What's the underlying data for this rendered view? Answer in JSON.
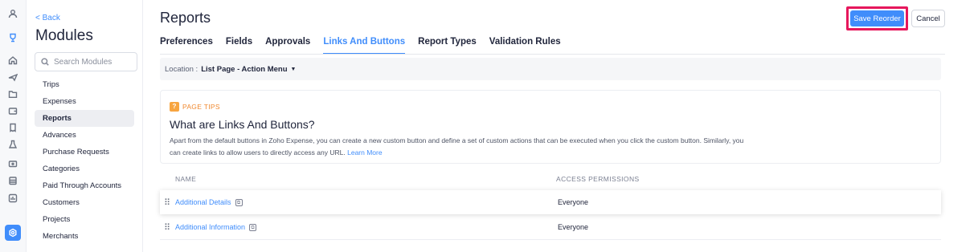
{
  "rail": {
    "icons": [
      "user-icon",
      "trophy-icon",
      "home-icon",
      "plane-icon",
      "folder-icon",
      "wallet-icon",
      "receipt-icon",
      "flask-icon",
      "card-icon",
      "bank-icon",
      "analytics-icon",
      "settings-icon"
    ],
    "active_color": "#408dfb"
  },
  "sidebar": {
    "back_label": "< Back",
    "title": "Modules",
    "search_placeholder": "Search Modules",
    "items": [
      {
        "label": "Trips"
      },
      {
        "label": "Expenses"
      },
      {
        "label": "Reports"
      },
      {
        "label": "Advances"
      },
      {
        "label": "Purchase Requests"
      },
      {
        "label": "Categories"
      },
      {
        "label": "Paid Through Accounts"
      },
      {
        "label": "Customers"
      },
      {
        "label": "Projects"
      },
      {
        "label": "Merchants"
      }
    ],
    "active_item": "Reports"
  },
  "header": {
    "title": "Reports",
    "save_label": "Save Reorder",
    "cancel_label": "Cancel"
  },
  "tabs": [
    {
      "label": "Preferences"
    },
    {
      "label": "Fields"
    },
    {
      "label": "Approvals"
    },
    {
      "label": "Links And Buttons"
    },
    {
      "label": "Report Types"
    },
    {
      "label": "Validation Rules"
    }
  ],
  "active_tab": "Links And Buttons",
  "location": {
    "label": "Location :",
    "value": "List Page - Action Menu"
  },
  "tips": {
    "badge": "?",
    "label": "PAGE TIPS",
    "heading": "What are Links And Buttons?",
    "body": "Apart from the default buttons in Zoho Expense, you can create a new custom button and define a set of custom actions that can be executed when you click the custom button. Similarly, you can create links to allow users to directly access any URL.",
    "learn_more": "Learn More"
  },
  "table": {
    "columns": [
      "NAME",
      "ACCESS PERMISSIONS"
    ],
    "rows": [
      {
        "name": "Additional Details",
        "access": "Everyone"
      },
      {
        "name": "Additional Information",
        "access": "Everyone"
      }
    ]
  },
  "colors": {
    "accent": "#408dfb",
    "highlight_border": "#e6175c",
    "tips_orange": "#f7a540"
  }
}
